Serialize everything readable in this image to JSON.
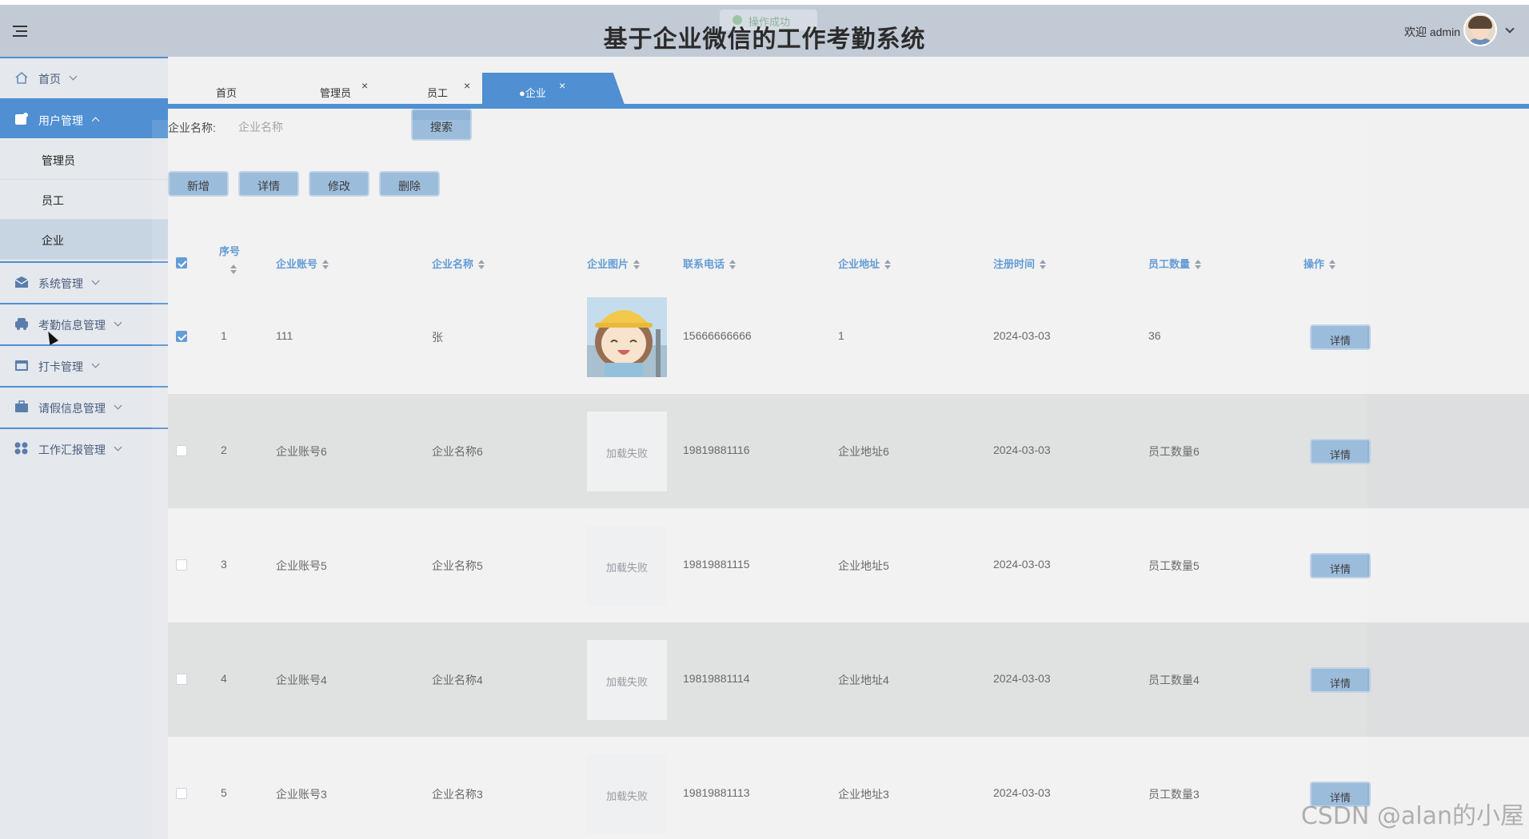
{
  "header": {
    "title": "基于企业微信的工作考勤系统",
    "toast": "操作成功",
    "welcome": "欢迎 admin"
  },
  "sidebar": {
    "items": [
      {
        "label": "首页",
        "icon": "home-icon"
      },
      {
        "label": "用户管理",
        "icon": "user-icon"
      },
      {
        "label": "系统管理",
        "icon": "mail-icon"
      },
      {
        "label": "考勤信息管理",
        "icon": "car-icon"
      },
      {
        "label": "打卡管理",
        "icon": "calendar-icon"
      },
      {
        "label": "请假信息管理",
        "icon": "briefcase-icon"
      },
      {
        "label": "工作汇报管理",
        "icon": "grid-icon"
      }
    ],
    "sub_items": [
      "管理员",
      "员工",
      "企业"
    ]
  },
  "tabs": [
    {
      "label": "首页"
    },
    {
      "label": "管理员"
    },
    {
      "label": "员工"
    },
    {
      "label": "●企业"
    }
  ],
  "search": {
    "label": "企业名称:",
    "placeholder": "企业名称",
    "button": "搜索"
  },
  "actions": [
    "新增",
    "详情",
    "修改",
    "删除"
  ],
  "table": {
    "headers": [
      "序号",
      "企业账号",
      "企业名称",
      "企业图片",
      "联系电话",
      "企业地址",
      "注册时间",
      "员工数量",
      "操作"
    ],
    "rows": [
      {
        "seq": "1",
        "account": "111",
        "name": "张",
        "image": "",
        "phone": "15666666666",
        "address": "1",
        "date": "2024-03-03",
        "count": "36",
        "checked": true
      },
      {
        "seq": "2",
        "account": "企业账号6",
        "name": "企业名称6",
        "image": "加载失败",
        "phone": "19819881116",
        "address": "企业地址6",
        "date": "2024-03-03",
        "count": "员工数量6",
        "checked": false
      },
      {
        "seq": "3",
        "account": "企业账号5",
        "name": "企业名称5",
        "image": "加载失败",
        "phone": "19819881115",
        "address": "企业地址5",
        "date": "2024-03-03",
        "count": "员工数量5",
        "checked": false
      },
      {
        "seq": "4",
        "account": "企业账号4",
        "name": "企业名称4",
        "image": "加载失败",
        "phone": "19819881114",
        "address": "企业地址4",
        "date": "2024-03-03",
        "count": "员工数量4",
        "checked": false
      },
      {
        "seq": "5",
        "account": "企业账号3",
        "name": "企业名称3",
        "image": "加载失败",
        "phone": "19819881113",
        "address": "企业地址3",
        "date": "2024-03-03",
        "count": "员工数量3",
        "checked": false
      }
    ],
    "detail_label": "详情"
  },
  "watermark": "CSDN @alan的小屋",
  "colors": {
    "accent": "#4f8fd2",
    "header_bg": "#c2cad6",
    "button": "#8fb3d6"
  }
}
